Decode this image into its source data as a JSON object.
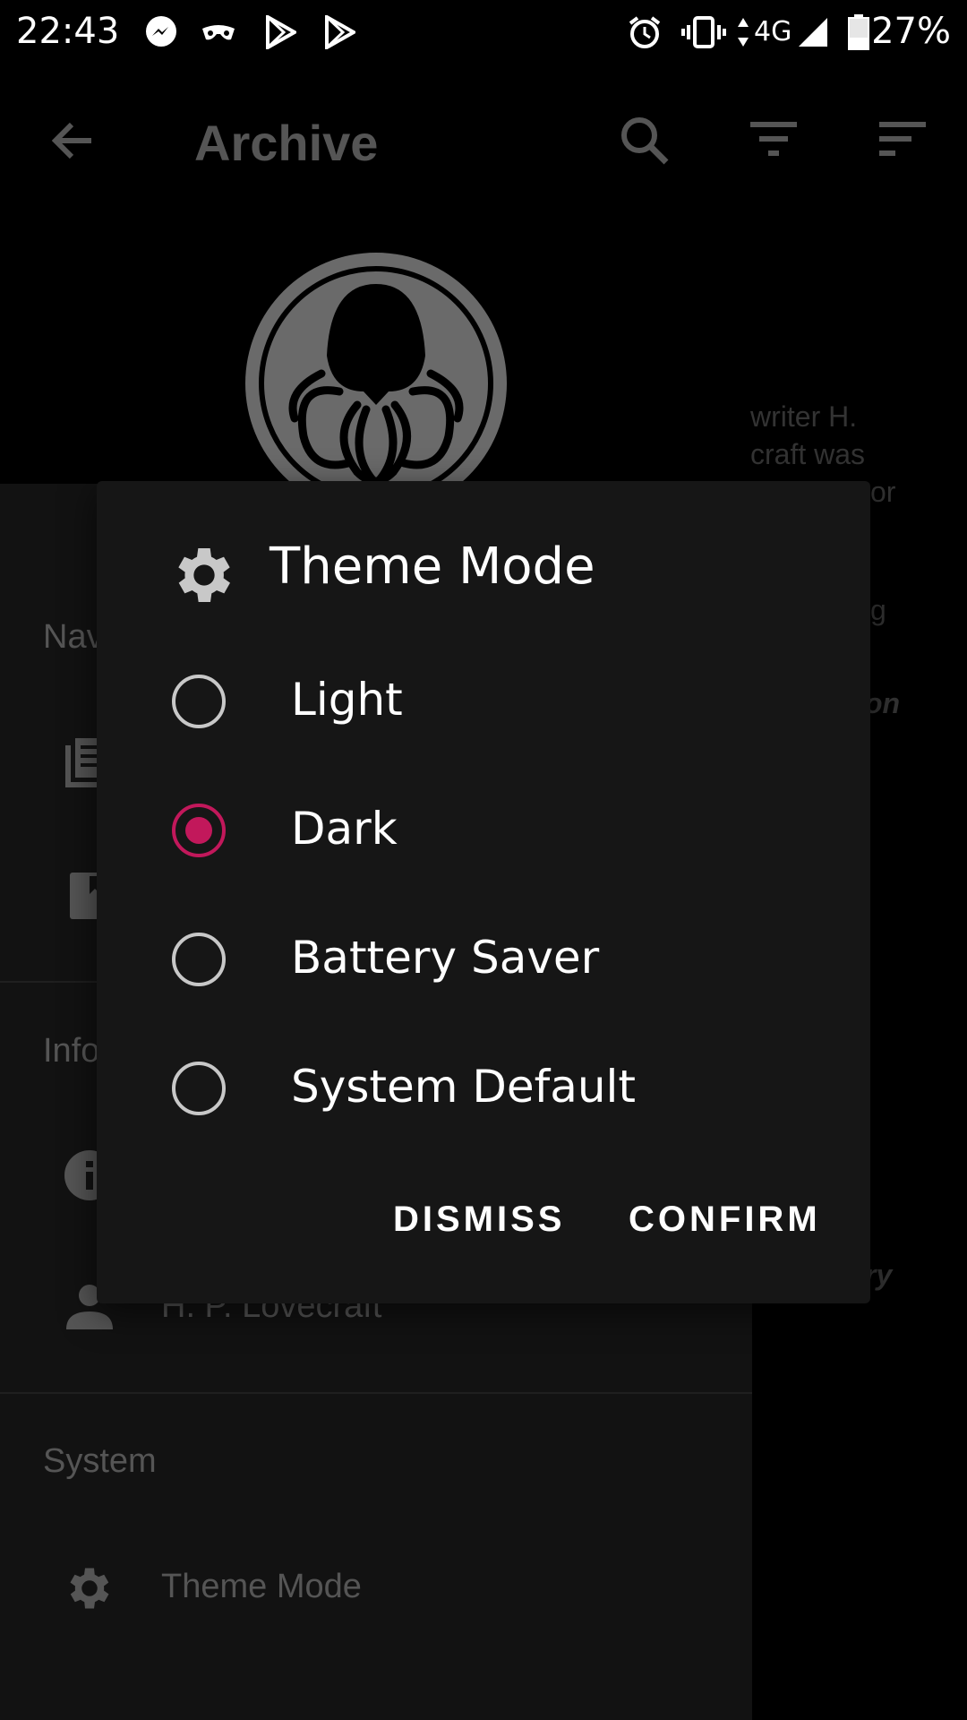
{
  "status_bar": {
    "time": "22:43",
    "network": "4G",
    "battery": "27%"
  },
  "app": {
    "toolbar": {
      "title": "Archive"
    },
    "partial_text": {
      "line1": "writer H.",
      "line2": "craft was",
      "line3": "or",
      "line4": "g",
      "line5": "on",
      "line6": "ry"
    }
  },
  "drawer": {
    "sections": {
      "navigation": "Nav",
      "info": "Info",
      "system": "System"
    },
    "author_label": "H. P. Lovecraft",
    "theme_mode_label": "Theme Mode"
  },
  "dialog": {
    "title": "Theme Mode",
    "options": [
      {
        "label": "Light",
        "selected": false
      },
      {
        "label": "Dark",
        "selected": true
      },
      {
        "label": "Battery Saver",
        "selected": false
      },
      {
        "label": "System Default",
        "selected": false
      }
    ],
    "dismiss_label": "DISMISS",
    "confirm_label": "CONFIRM"
  },
  "colors": {
    "accent": "#c2185b",
    "dialog_bg": "#161616",
    "scrim_text": "#555555"
  }
}
